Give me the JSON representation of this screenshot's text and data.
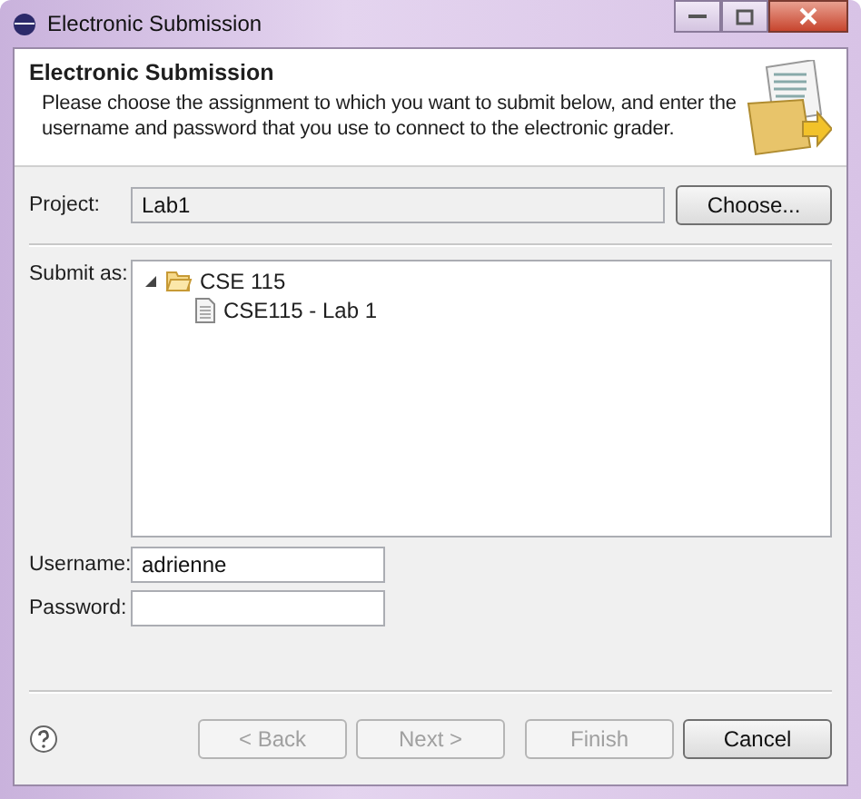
{
  "window": {
    "title": "Electronic Submission"
  },
  "header": {
    "title": "Electronic Submission",
    "description": "Please choose the assignment to which you want to submit below, and enter the username and password that you use to connect to the electronic grader."
  },
  "project": {
    "label": "Project:",
    "value": "Lab1",
    "button": "Choose..."
  },
  "submit_as": {
    "label": "Submit as:",
    "tree": [
      {
        "label": "CSE 115",
        "kind": "folder",
        "expanded": true,
        "children": [
          {
            "label": "CSE115 - Lab 1",
            "kind": "file"
          }
        ]
      }
    ]
  },
  "username": {
    "label": "Username:",
    "value": "adrienne"
  },
  "password": {
    "label": "Password:"
  },
  "buttons": [
    {
      "label": "< Back",
      "disabled": true
    },
    {
      "label": "Next >",
      "disabled": true
    },
    {
      "label": "Finish",
      "disabled": true
    },
    {
      "label": "Cancel",
      "disabled": false
    }
  ]
}
